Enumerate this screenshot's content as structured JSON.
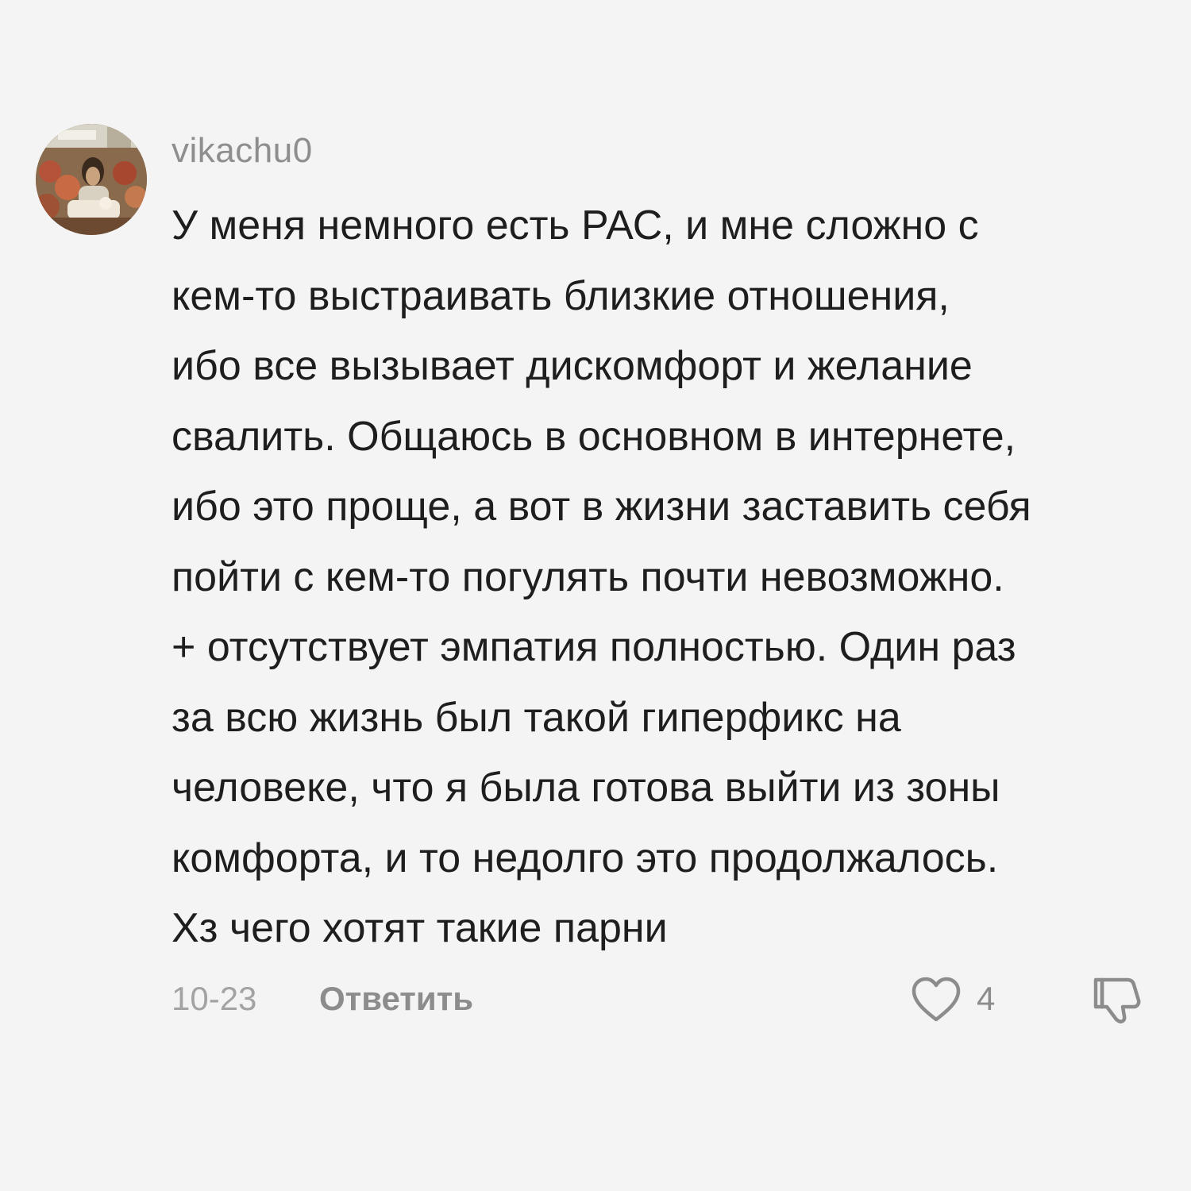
{
  "comment": {
    "username": "vikachu0",
    "avatar_icon": "user-avatar-photo",
    "text_lines": [
      "У меня немного есть РАС, и мне сложно с",
      "кем-то выстраивать близкие отношения,",
      "ибо все вызывает дискомфорт и желание",
      "свалить. Общаюсь в основном в интернете,",
      "ибо это проще, а вот в жизни заставить себя",
      "пойти с кем-то погулять почти невозможно.",
      "+ отсутствует эмпатия полностью. Один раз",
      "за всю жизнь был такой гиперфикс на",
      "человеке, что я была готова выйти из зоны",
      "комфорта, и то недолго это продолжалось.",
      "Хз чего хотят такие парни"
    ],
    "date": "10-23",
    "reply_label": "Ответить",
    "like_icon": "heart-outline-icon",
    "like_count": "4",
    "dislike_icon": "thumbs-down-outline-icon"
  },
  "colors": {
    "background": "#f4f4f4",
    "text": "#1e1e1e",
    "muted": "#8c8c8c"
  }
}
